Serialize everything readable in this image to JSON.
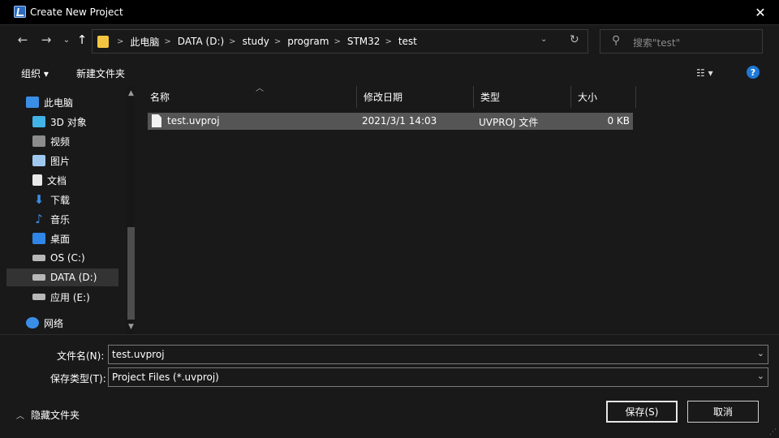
{
  "window": {
    "title": "Create New Project",
    "close": "✕"
  },
  "address": {
    "crumbs": [
      "此电脑",
      "DATA (D:)",
      "study",
      "program",
      "STM32",
      "test"
    ],
    "search_placeholder": "搜索\"test\""
  },
  "toolbar": {
    "organize": "组织 ▾",
    "new_folder": "新建文件夹"
  },
  "nav_items": [
    {
      "label": "此电脑",
      "icon": "computer-icon",
      "color": "#3a8ee6"
    },
    {
      "label": "3D 对象",
      "icon": "cube-icon",
      "color": "#42b3e6"
    },
    {
      "label": "视频",
      "icon": "video-icon",
      "color": "#8c8c8c"
    },
    {
      "label": "图片",
      "icon": "pictures-icon",
      "color": "#9fc8ef"
    },
    {
      "label": "文档",
      "icon": "document-icon",
      "color": "#e8e8e8"
    },
    {
      "label": "下载",
      "icon": "download-icon",
      "color": "#3a8ee6"
    },
    {
      "label": "音乐",
      "icon": "music-icon",
      "color": "#3a8ee6"
    },
    {
      "label": "桌面",
      "icon": "desktop-icon",
      "color": "#2f86e8"
    },
    {
      "label": "OS (C:)",
      "icon": "drive-icon",
      "color": "#b8b8b8"
    },
    {
      "label": "DATA (D:)",
      "icon": "drive-icon",
      "color": "#b8b8b8"
    },
    {
      "label": "应用 (E:)",
      "icon": "drive-icon",
      "color": "#b8b8b8"
    },
    {
      "label": "网络",
      "icon": "network-icon",
      "color": "#3a8ee6"
    }
  ],
  "columns": [
    "名称",
    "修改日期",
    "类型",
    "大小"
  ],
  "files": [
    {
      "name": "test.uvproj",
      "modified": "2021/3/1 14:03",
      "type": "UVPROJ 文件",
      "size": "0 KB"
    }
  ],
  "form": {
    "filename_label": "文件名(N):",
    "filename_value": "test.uvproj",
    "filetype_label": "保存类型(T):",
    "filetype_value": "Project Files (*.uvproj)",
    "hide_folders": "隐藏文件夹",
    "save": "保存(S)",
    "cancel": "取消"
  }
}
